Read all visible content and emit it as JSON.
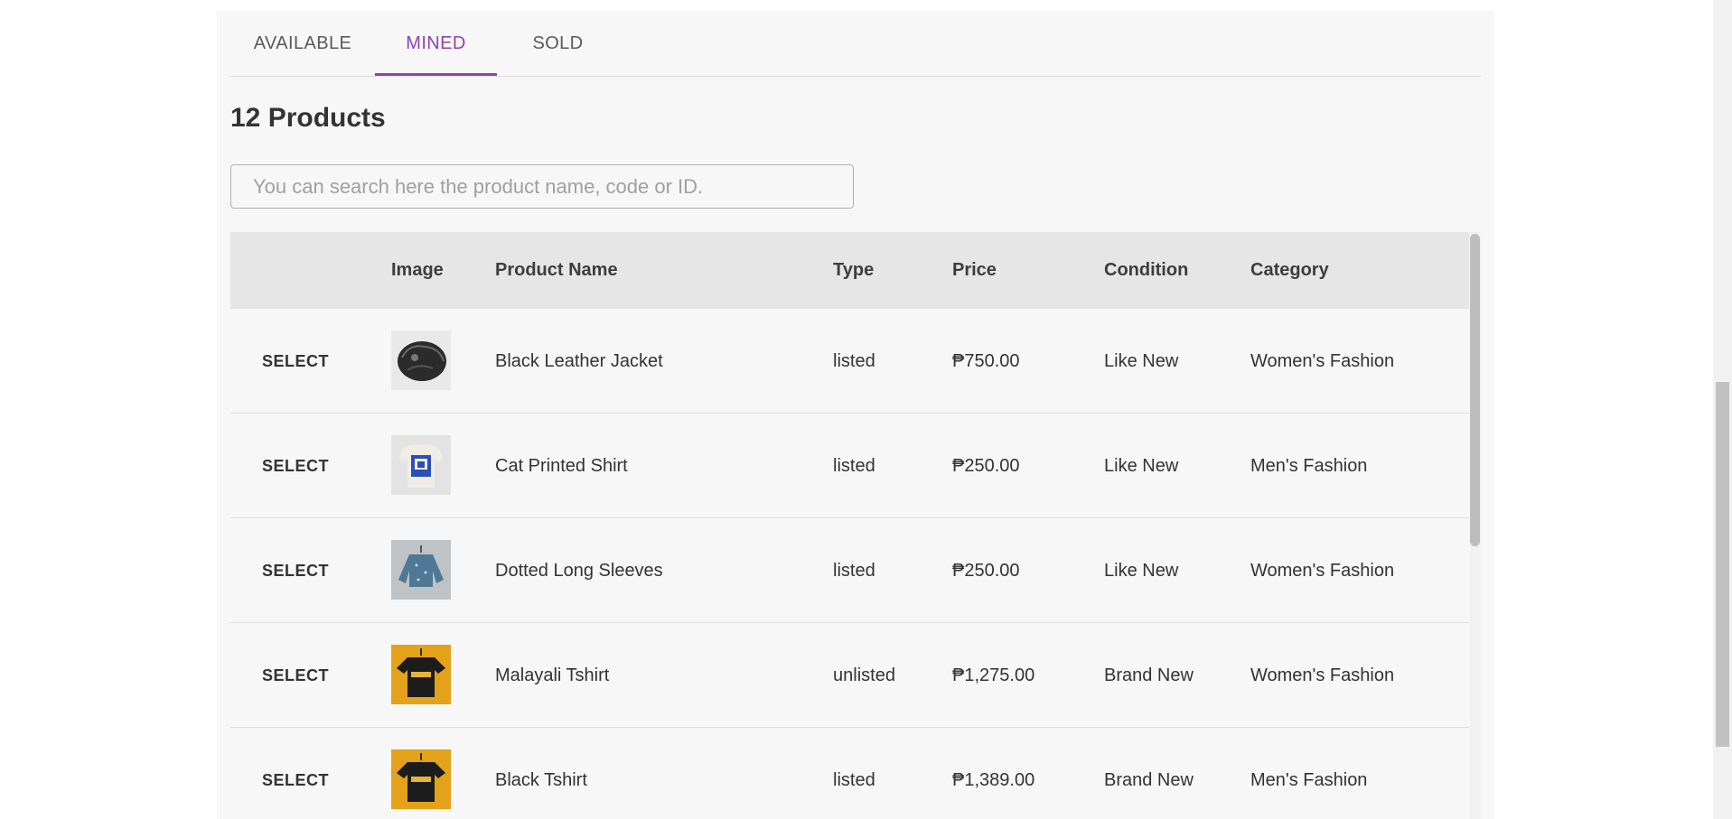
{
  "tabs": [
    {
      "label": "AVAILABLE",
      "active": false
    },
    {
      "label": "MINED",
      "active": true
    },
    {
      "label": "SOLD",
      "active": false
    }
  ],
  "accent_color": "#8e44ad",
  "heading": "12 Products",
  "search": {
    "placeholder": "You can search here the product name, code or ID.",
    "value": ""
  },
  "table": {
    "columns": [
      "",
      "Image",
      "Product Name",
      "Type",
      "Price",
      "Condition",
      "Category"
    ],
    "rows": [
      {
        "action": "SELECT",
        "image": "black-leather-jacket-photo",
        "name": "Black Leather Jacket",
        "type": "listed",
        "price": "₱750.00",
        "condition": "Like New",
        "category": "Women's Fashion"
      },
      {
        "action": "SELECT",
        "image": "cat-printed-shirt-photo",
        "name": "Cat Printed Shirt",
        "type": "listed",
        "price": "₱250.00",
        "condition": "Like New",
        "category": "Men's Fashion"
      },
      {
        "action": "SELECT",
        "image": "dotted-long-sleeves-photo",
        "name": "Dotted Long Sleeves",
        "type": "listed",
        "price": "₱250.00",
        "condition": "Like New",
        "category": "Women's Fashion"
      },
      {
        "action": "SELECT",
        "image": "malayali-tshirt-photo",
        "name": "Malayali Tshirt",
        "type": "unlisted",
        "price": "₱1,275.00",
        "condition": "Brand New",
        "category": "Women's Fashion"
      },
      {
        "action": "SELECT",
        "image": "black-tshirt-photo",
        "name": "Black Tshirt",
        "type": "listed",
        "price": "₱1,389.00",
        "condition": "Brand New",
        "category": "Men's Fashion"
      }
    ]
  }
}
